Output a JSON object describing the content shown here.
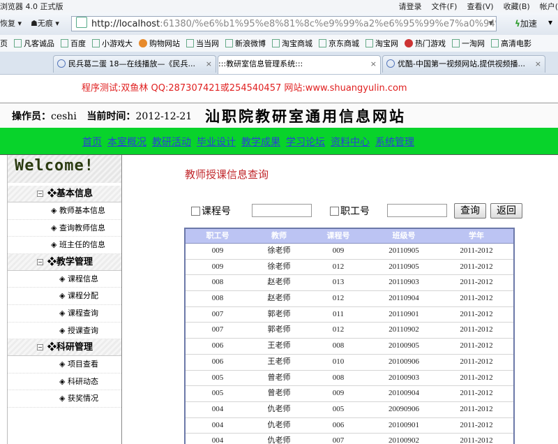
{
  "browser": {
    "app_title": "浏览器 4.0 正式版",
    "menus": [
      "请登录",
      "文件(F)",
      "查看(V)",
      "收藏(B)",
      "帐户("
    ],
    "back_label": "恢复",
    "mode_label": "无痕",
    "url_host": "http://localhost",
    "url_rest": ":61380/%e6%b1%95%e8%81%8c%e9%99%a2%e6%95%99%e7%a0%94%e5%ae%",
    "go_label": "加速",
    "favorites": [
      {
        "label": "页",
        "icon": "page-icon"
      },
      {
        "label": "凡客诚品",
        "icon": "page-icon"
      },
      {
        "label": "百度",
        "icon": "page-icon"
      },
      {
        "label": "小游戏大",
        "icon": "page-icon"
      },
      {
        "label": "购物网站",
        "icon": "shop-icon"
      },
      {
        "label": "当当网",
        "icon": "page-icon"
      },
      {
        "label": "新浪微博",
        "icon": "page-icon"
      },
      {
        "label": "淘宝商城",
        "icon": "page-icon"
      },
      {
        "label": "京东商城",
        "icon": "page-icon"
      },
      {
        "label": "淘宝网",
        "icon": "page-icon"
      },
      {
        "label": "热门游戏",
        "icon": "game-icon"
      },
      {
        "label": "一淘网",
        "icon": "page-icon"
      },
      {
        "label": "高清电影",
        "icon": "page-icon"
      }
    ],
    "tabs": [
      {
        "label": "民兵葛二蛋 18—在线播放—《民兵..."
      },
      {
        "label": ":::教研室信息管理系统:::"
      },
      {
        "label": "优酷-中国第一视频网站,提供视频播..."
      }
    ]
  },
  "page": {
    "notice": "程序测试:双鱼林 QQ:287307421或254540457 网站:www.shuangyulin.com",
    "operator_label": "操作员：",
    "operator_value": "ceshi",
    "time_label": "当前时间：",
    "time_value": "2012-12-21",
    "site_title": "汕职院教研室通用信息网站",
    "nav": [
      "首页",
      "本室概况",
      "教研活动",
      "毕业设计",
      "教学成果",
      "学习论坛",
      "资料中心",
      "系统管理"
    ],
    "welcome_text": "Welcome!",
    "sidebar": [
      {
        "group": "基本信息",
        "items": [
          "教师基本信息",
          "查询教师信息",
          "班主任的信息"
        ],
        "deep": false
      },
      {
        "group": "教学管理",
        "items": [
          "课程信息",
          "课程分配",
          "课程查询",
          "授课查询"
        ],
        "deep": true
      },
      {
        "group": "科研管理",
        "items": [
          "项目查看",
          "科研动态",
          "获奖情况"
        ],
        "deep": true
      }
    ],
    "content_title": "教师授课信息查询",
    "search": {
      "course_label": "课程号",
      "staff_label": "职工号",
      "query_button": "查询",
      "back_button": "返回"
    },
    "table": {
      "headers": [
        "职工号",
        "教师",
        "课程号",
        "班级号",
        "学年"
      ],
      "rows": [
        [
          "009",
          "徐老师",
          "009",
          "20110905",
          "2011-2012"
        ],
        [
          "009",
          "徐老师",
          "012",
          "20110905",
          "2011-2012"
        ],
        [
          "008",
          "赵老师",
          "013",
          "20110903",
          "2011-2012"
        ],
        [
          "008",
          "赵老师",
          "012",
          "20110904",
          "2011-2012"
        ],
        [
          "007",
          "郭老师",
          "011",
          "20110901",
          "2011-2012"
        ],
        [
          "007",
          "郭老师",
          "012",
          "20110902",
          "2011-2012"
        ],
        [
          "006",
          "王老师",
          "008",
          "20100905",
          "2011-2012"
        ],
        [
          "006",
          "王老师",
          "010",
          "20100906",
          "2011-2012"
        ],
        [
          "005",
          "曾老师",
          "008",
          "20100903",
          "2011-2012"
        ],
        [
          "005",
          "曾老师",
          "009",
          "20100904",
          "2011-2012"
        ],
        [
          "004",
          "仇老师",
          "005",
          "20090906",
          "2011-2012"
        ],
        [
          "004",
          "仇老师",
          "006",
          "20100901",
          "2011-2012"
        ],
        [
          "004",
          "仇老师",
          "007",
          "20100902",
          "2011-2012"
        ]
      ]
    }
  }
}
